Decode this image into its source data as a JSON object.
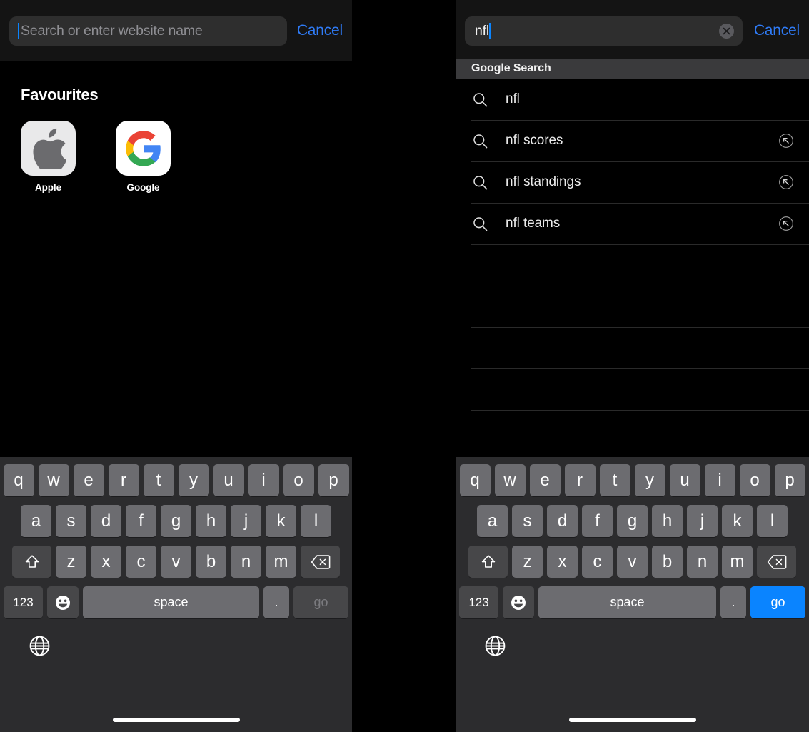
{
  "left_panel": {
    "search": {
      "placeholder": "Search or enter website name",
      "value": "",
      "cancel_label": "Cancel"
    },
    "favourites": {
      "title": "Favourites",
      "items": [
        {
          "label": "Apple",
          "icon": "apple-logo"
        },
        {
          "label": "Google",
          "icon": "google-logo"
        }
      ]
    },
    "keyboard": {
      "row1": [
        "q",
        "w",
        "e",
        "r",
        "t",
        "y",
        "u",
        "i",
        "o",
        "p"
      ],
      "row2": [
        "a",
        "s",
        "d",
        "f",
        "g",
        "h",
        "j",
        "k",
        "l"
      ],
      "row3": [
        "z",
        "x",
        "c",
        "v",
        "b",
        "n",
        "m"
      ],
      "shift_icon": "shift-icon",
      "delete_icon": "delete-icon",
      "numbers_label": "123",
      "emoji_icon": "emoji-icon",
      "space_label": "space",
      "period_label": ".",
      "go_label": "go",
      "go_enabled": false,
      "globe_icon": "globe-icon"
    }
  },
  "right_panel": {
    "search": {
      "placeholder": "Search or enter website name",
      "value": "nfl",
      "cancel_label": "Cancel",
      "clear_icon": "clear-circle-icon"
    },
    "suggestions": {
      "header": "Google Search",
      "items": [
        {
          "label": "nfl",
          "icon": "search-icon",
          "arrow": false
        },
        {
          "label": "nfl scores",
          "icon": "search-icon",
          "arrow": true
        },
        {
          "label": "nfl standings",
          "icon": "search-icon",
          "arrow": true
        },
        {
          "label": "nfl teams",
          "icon": "search-icon",
          "arrow": true
        }
      ],
      "empty_rows": 5
    },
    "keyboard": {
      "row1": [
        "q",
        "w",
        "e",
        "r",
        "t",
        "y",
        "u",
        "i",
        "o",
        "p"
      ],
      "row2": [
        "a",
        "s",
        "d",
        "f",
        "g",
        "h",
        "j",
        "k",
        "l"
      ],
      "row3": [
        "z",
        "x",
        "c",
        "v",
        "b",
        "n",
        "m"
      ],
      "shift_icon": "shift-icon",
      "delete_icon": "delete-icon",
      "numbers_label": "123",
      "emoji_icon": "emoji-icon",
      "space_label": "space",
      "period_label": ".",
      "go_label": "go",
      "go_enabled": true,
      "globe_icon": "globe-icon"
    }
  },
  "colors": {
    "accent_blue": "#0a84ff",
    "cancel_blue": "#2f7bf6",
    "key_grey": "#6c6c70",
    "key_dark_grey": "#474749",
    "keyboard_bg": "#2c2c2e",
    "header_bg": "#3a3a3c",
    "field_bg": "#2e2e2e",
    "background": "#000000"
  }
}
